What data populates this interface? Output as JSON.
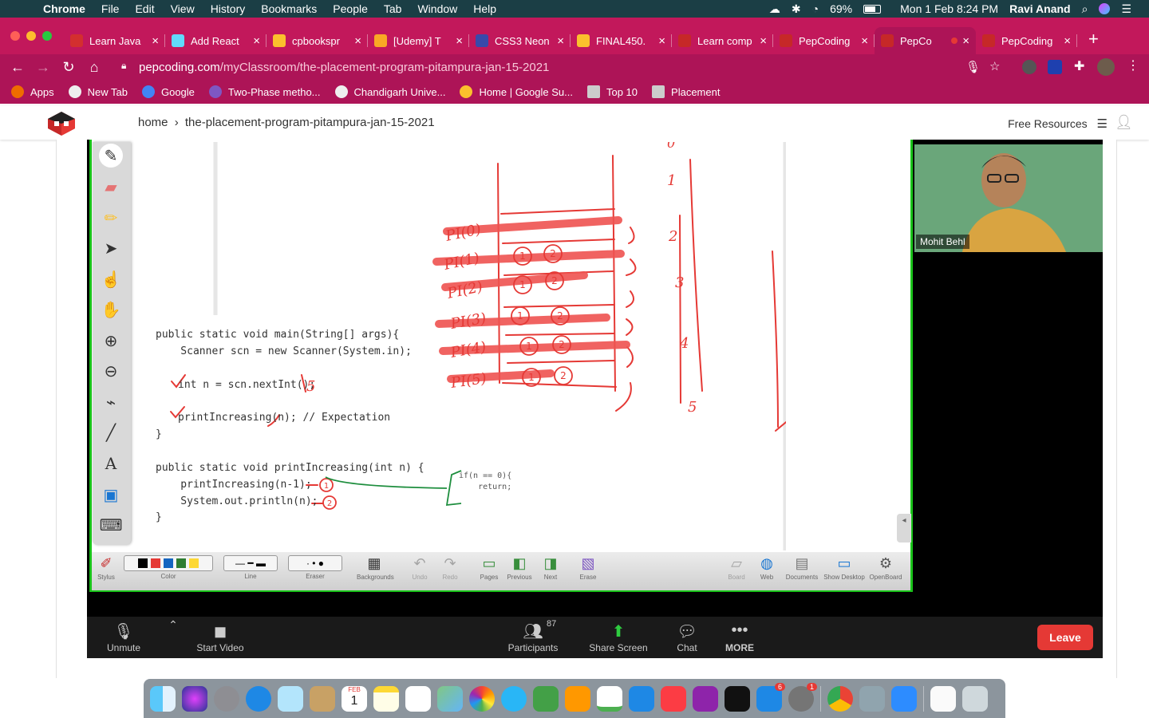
{
  "menubar": {
    "app": "Chrome",
    "items": [
      "File",
      "Edit",
      "View",
      "History",
      "Bookmarks",
      "People",
      "Tab",
      "Window",
      "Help"
    ],
    "battery": "69%",
    "datetime": "Mon 1 Feb  8:24 PM",
    "user": "Ravi Anand"
  },
  "tabs": [
    {
      "title": "Learn Java",
      "color": "#d32f2f"
    },
    {
      "title": "Add React",
      "color": "#61dafb"
    },
    {
      "title": "cpbookspr",
      "color": "#fbc02d"
    },
    {
      "title": "[Udemy] T",
      "color": "#f9a825"
    },
    {
      "title": "CSS3 Neon",
      "color": "#3949ab"
    },
    {
      "title": "FINAL450.",
      "color": "#fbc02d"
    },
    {
      "title": "Learn comp",
      "color": "#c62828"
    },
    {
      "title": "PepCoding",
      "color": "#c62828"
    },
    {
      "title": "PepCo",
      "color": "#c62828",
      "active": true
    },
    {
      "title": "PepCoding",
      "color": "#c62828"
    }
  ],
  "address": {
    "host": "pepcoding.com",
    "path": "/myClassroom/the-placement-program-pitampura-jan-15-2021"
  },
  "bookmarks": [
    {
      "label": "Apps",
      "color": "#ef6c00"
    },
    {
      "label": "New Tab",
      "color": "#eeeeee"
    },
    {
      "label": "Google",
      "color": "#4285f4"
    },
    {
      "label": "Two-Phase metho...",
      "color": "#7e57c2"
    },
    {
      "label": "Chandigarh Unive...",
      "color": "#eeeeee"
    },
    {
      "label": "Home | Google Su...",
      "color": "#fbc02d"
    },
    {
      "label": "Top 10",
      "color": "#cccccc"
    },
    {
      "label": "Placement",
      "color": "#cccccc"
    }
  ],
  "site": {
    "breadcrumb_home": "home",
    "breadcrumb_sep": "›",
    "breadcrumb_page": "the-placement-program-pitampura-jan-15-2021",
    "free_resources": "Free Resources"
  },
  "code": {
    "l1": "public static void main(String[] args){",
    "l2": "    Scanner scn = new Scanner(System.in);",
    "l3": "int n = scn.nextInt();",
    "l4": "printIncreasing(n); // Expectation",
    "l5": "}",
    "l6": "public static void printIncreasing(int n) {",
    "l7": "    printIncreasing(n-1);",
    "l8": "    System.out.println(n);",
    "l9": "}",
    "base1": "if(n == 0){",
    "base2": "    return;"
  },
  "annotations": {
    "input": "5",
    "stack": [
      "PI(0)",
      "PI(1)",
      "PI(2)",
      "PI(3)",
      "PI(4)",
      "PI(5)"
    ],
    "marks": [
      "1",
      "2"
    ],
    "output": [
      "1",
      "2",
      "3",
      "4",
      "5"
    ],
    "arrows": [
      "0",
      "1",
      "2",
      "3",
      "4",
      "5"
    ]
  },
  "toolbar": [
    {
      "label": "Stylus"
    },
    {
      "label": "Color"
    },
    {
      "label": "Line"
    },
    {
      "label": "Eraser"
    },
    {
      "label": "Backgrounds"
    },
    {
      "label": "Undo"
    },
    {
      "label": "Redo"
    },
    {
      "label": "Pages"
    },
    {
      "label": "Previous"
    },
    {
      "label": "Next"
    },
    {
      "label": "Erase"
    },
    {
      "label": "Board"
    },
    {
      "label": "Web"
    },
    {
      "label": "Documents"
    },
    {
      "label": "Show Desktop"
    },
    {
      "label": "OpenBoard"
    }
  ],
  "video": {
    "name": "Mohit Behl"
  },
  "zoom": {
    "unmute": "Unmute",
    "start_video": "Start Video",
    "participants": "Participants",
    "participants_count": "87",
    "share_screen": "Share Screen",
    "chat": "Chat",
    "more": "MORE",
    "leave": "Leave"
  },
  "dock": {
    "calendar_month": "FEB",
    "calendar_day": "1",
    "badges": {
      "appstore": "6",
      "settings": "1"
    }
  }
}
